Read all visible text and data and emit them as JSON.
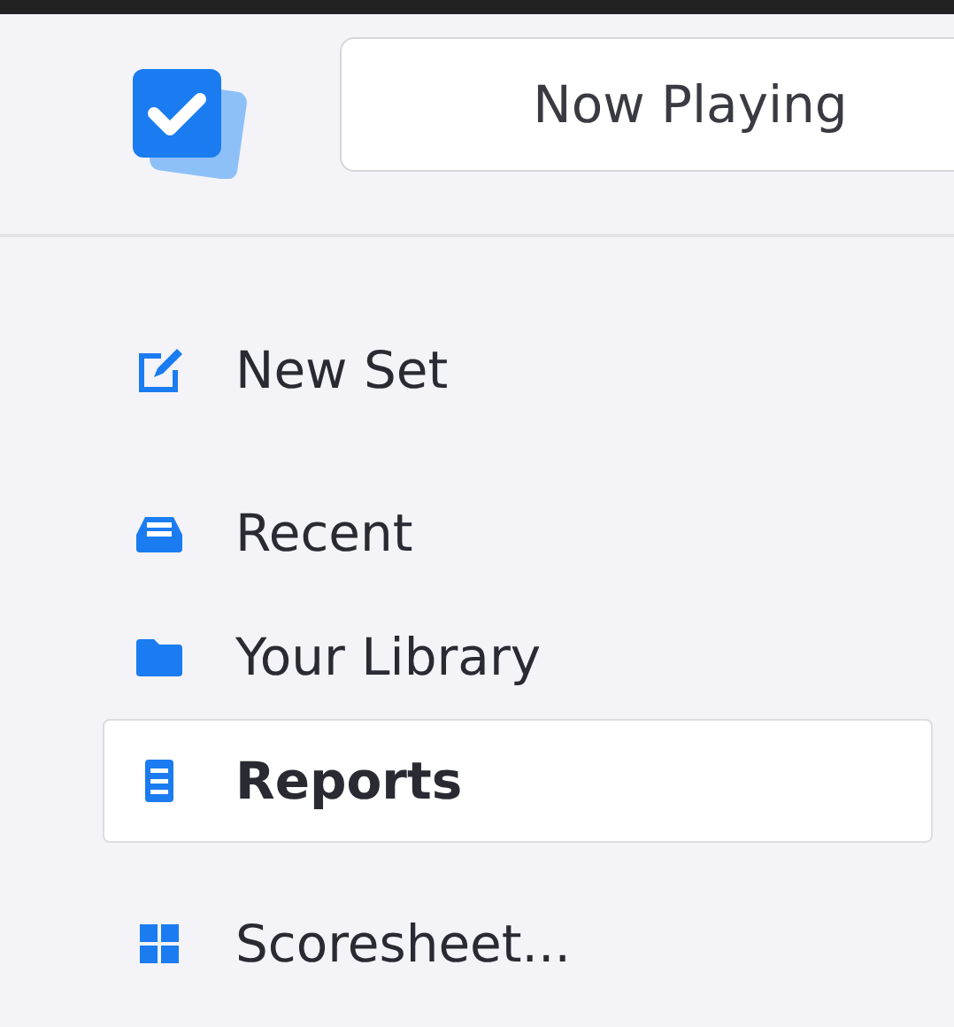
{
  "header": {
    "now_playing_button": "Now Playing"
  },
  "sidebar": {
    "sections": [
      {
        "items": [
          {
            "kind": "compose",
            "label": "New Set",
            "selected": false
          }
        ]
      },
      {
        "items": [
          {
            "kind": "tray",
            "label": "Recent",
            "selected": false
          },
          {
            "kind": "folder",
            "label": "Your Library",
            "selected": false
          },
          {
            "kind": "list",
            "label": "Reports",
            "selected": true
          }
        ]
      },
      {
        "items": [
          {
            "kind": "grid",
            "label": "Scoresheet...",
            "selected": false
          }
        ]
      }
    ]
  }
}
